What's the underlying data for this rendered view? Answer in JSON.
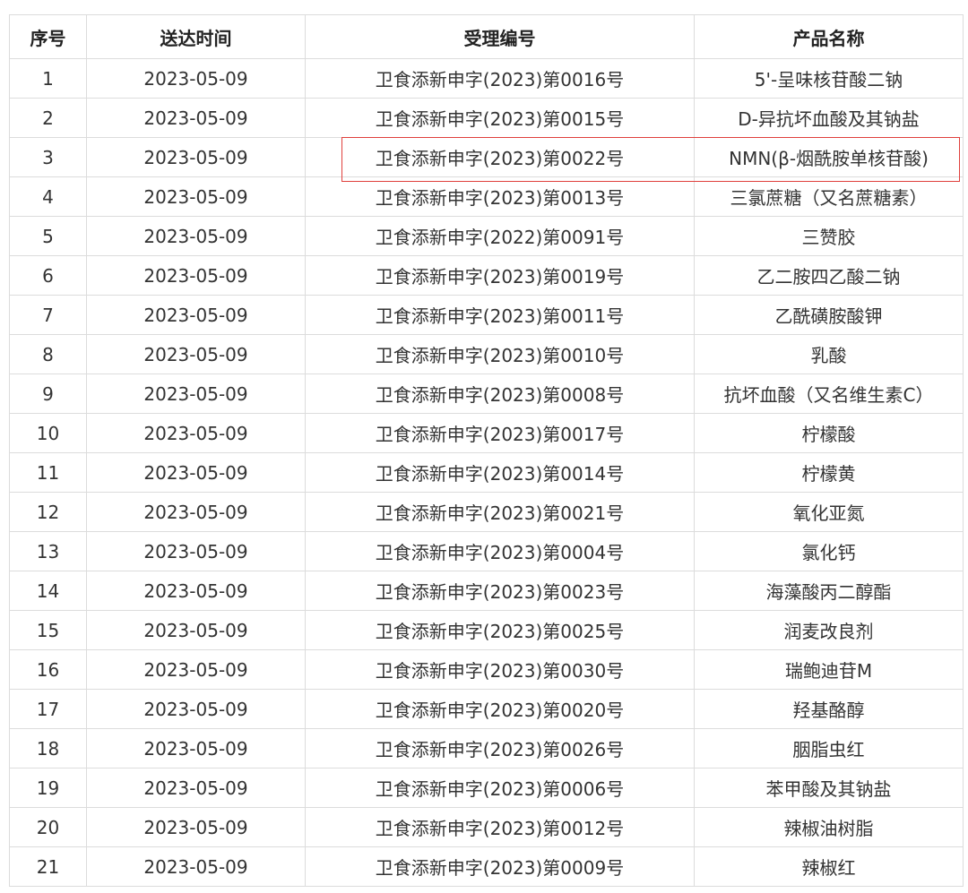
{
  "table": {
    "headers": [
      "序号",
      "送达时间",
      "受理编号",
      "产品名称"
    ],
    "rows": [
      [
        "1",
        "2023-05-09",
        "卫食添新申字(2023)第0016号",
        "5'-呈味核苷酸二钠"
      ],
      [
        "2",
        "2023-05-09",
        "卫食添新申字(2023)第0015号",
        "D-异抗坏血酸及其钠盐"
      ],
      [
        "3",
        "2023-05-09",
        "卫食添新申字(2023)第0022号",
        "NMN(β-烟酰胺单核苷酸)"
      ],
      [
        "4",
        "2023-05-09",
        "卫食添新申字(2023)第0013号",
        "三氯蔗糖（又名蔗糖素）"
      ],
      [
        "5",
        "2023-05-09",
        "卫食添新申字(2022)第0091号",
        "三赞胶"
      ],
      [
        "6",
        "2023-05-09",
        "卫食添新申字(2023)第0019号",
        "乙二胺四乙酸二钠"
      ],
      [
        "7",
        "2023-05-09",
        "卫食添新申字(2023)第0011号",
        "乙酰磺胺酸钾"
      ],
      [
        "8",
        "2023-05-09",
        "卫食添新申字(2023)第0010号",
        "乳酸"
      ],
      [
        "9",
        "2023-05-09",
        "卫食添新申字(2023)第0008号",
        "抗坏血酸（又名维生素C）"
      ],
      [
        "10",
        "2023-05-09",
        "卫食添新申字(2023)第0017号",
        "柠檬酸"
      ],
      [
        "11",
        "2023-05-09",
        "卫食添新申字(2023)第0014号",
        "柠檬黄"
      ],
      [
        "12",
        "2023-05-09",
        "卫食添新申字(2023)第0021号",
        "氧化亚氮"
      ],
      [
        "13",
        "2023-05-09",
        "卫食添新申字(2023)第0004号",
        "氯化钙"
      ],
      [
        "14",
        "2023-05-09",
        "卫食添新申字(2023)第0023号",
        "海藻酸丙二醇酯"
      ],
      [
        "15",
        "2023-05-09",
        "卫食添新申字(2023)第0025号",
        "润麦改良剂"
      ],
      [
        "16",
        "2023-05-09",
        "卫食添新申字(2023)第0030号",
        "瑞鲍迪苷M"
      ],
      [
        "17",
        "2023-05-09",
        "卫食添新申字(2023)第0020号",
        "羟基酪醇"
      ],
      [
        "18",
        "2023-05-09",
        "卫食添新申字(2023)第0026号",
        "胭脂虫红"
      ],
      [
        "19",
        "2023-05-09",
        "卫食添新申字(2023)第0006号",
        "苯甲酸及其钠盐"
      ],
      [
        "20",
        "2023-05-09",
        "卫食添新申字(2023)第0012号",
        "辣椒油树脂"
      ],
      [
        "21",
        "2023-05-09",
        "卫食添新申字(2023)第0009号",
        "辣椒红"
      ]
    ]
  },
  "highlight": {
    "row": 3,
    "color": "#e0403c"
  },
  "colors": {
    "border": "#dcdcdc",
    "text": "#333333",
    "header_text": "#222222"
  }
}
